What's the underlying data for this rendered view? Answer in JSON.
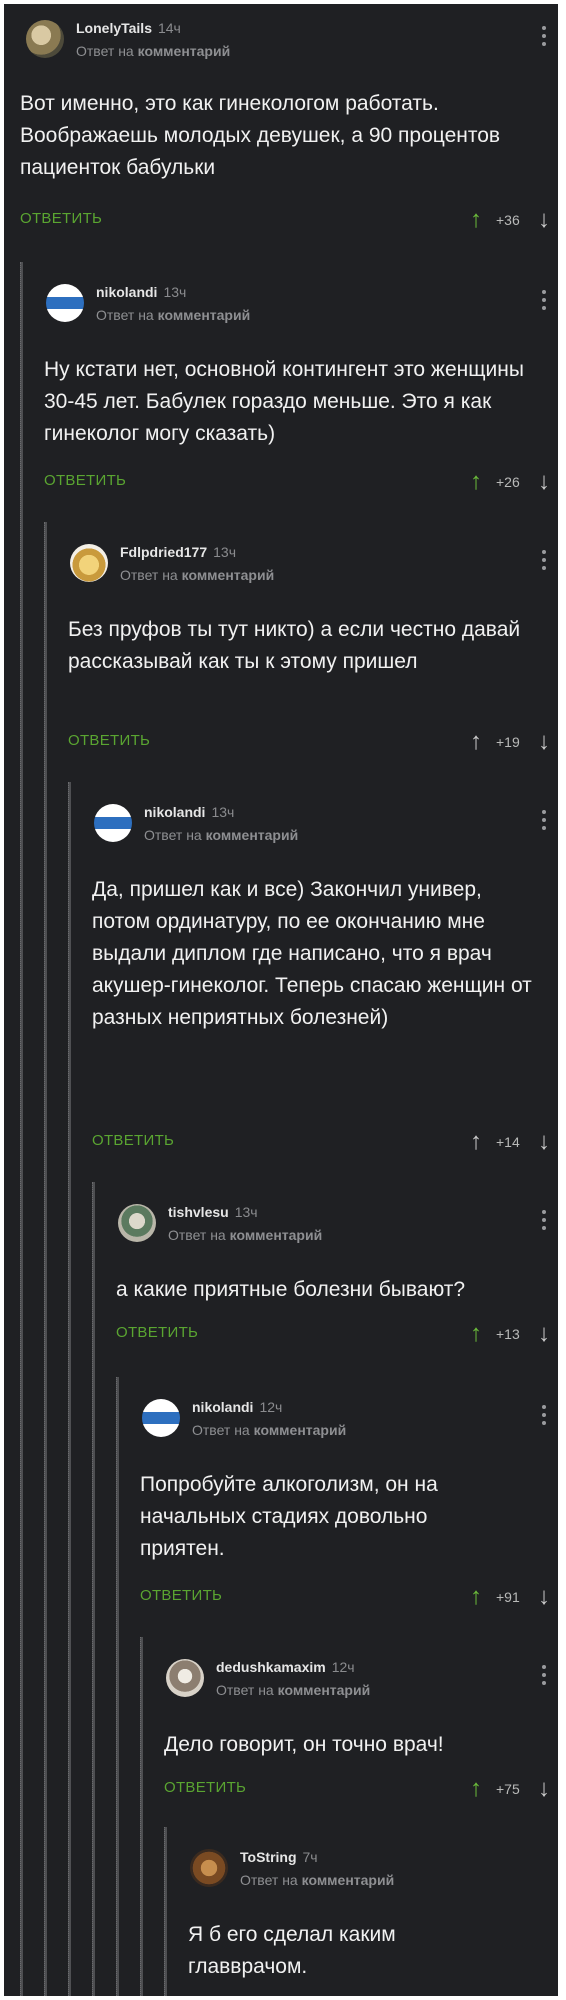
{
  "labels": {
    "reply_to": "Ответ на",
    "comment_word": "комментарий",
    "reply_action": "ОТВЕТИТЬ",
    "up_icon": "arrow-up-icon",
    "down_icon": "arrow-down-icon"
  },
  "comments": [
    {
      "author": "LonelyTails",
      "time": "14ч",
      "text": "Вот именно, это как гинекологом работать. Воображаешь молодых девушек, а 90 процентов пациенток бабульки",
      "score": "+36",
      "upvoted": true
    },
    {
      "author": "nikolandi",
      "time": "13ч",
      "text": "Ну кстати нет, основной контингент это женщины 30-45 лет. Бабулек гораздо меньше. Это я как гинеколог могу сказать)",
      "score": "+26",
      "upvoted": true
    },
    {
      "author": "Fdlpdried177",
      "time": "13ч",
      "text": "Без пруфов ты тут никто) а если честно давай рассказывай как ты к этому пришел",
      "score": "+19",
      "upvoted": false
    },
    {
      "author": "nikolandi",
      "time": "13ч",
      "text": "Да, пришел как и все) Закончил универ, потом ординатуру, по ее окончанию мне выдали диплом где написано, что я врач акушер-гинеколог. Теперь спасаю женщин от разных неприятных болезней)",
      "score": "+14",
      "upvoted": false
    },
    {
      "author": "tishvlesu",
      "time": "13ч",
      "text": "а какие приятные болезни бывают?",
      "score": "+13",
      "upvoted": true
    },
    {
      "author": "nikolandi",
      "time": "12ч",
      "text": "Попробуйте алкоголизм, он на начальных стадиях довольно приятен.",
      "score": "+91",
      "upvoted": true
    },
    {
      "author": "dedushkamaxim",
      "time": "12ч",
      "text": "Дело говорит, он точно врач!",
      "score": "+75",
      "upvoted": true
    },
    {
      "author": "ToString",
      "time": "7ч",
      "text": "Я б его сделал каким главврачом.",
      "score": "",
      "upvoted": false
    }
  ]
}
